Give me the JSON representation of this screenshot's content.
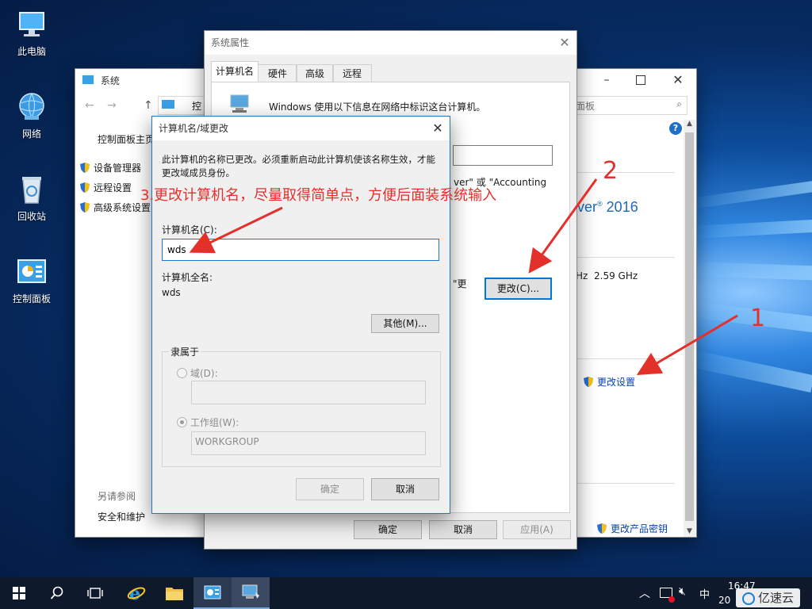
{
  "desktop": {
    "icons": [
      {
        "label": "此电脑",
        "icon": "computer-icon"
      },
      {
        "label": "网络",
        "icon": "network-globe-icon"
      },
      {
        "label": "回收站",
        "icon": "recycle-bin-icon"
      },
      {
        "label": "控制面板",
        "icon": "control-panel-icon"
      }
    ]
  },
  "system_window": {
    "title": "系统",
    "address": "控",
    "search_hint": "面板",
    "sidebar": {
      "home": "控制面板主页",
      "items": [
        "设备管理器",
        "远程设置",
        "高级系统设置"
      ],
      "see_also": "另请参阅",
      "see_also_items": [
        "安全和维护"
      ]
    },
    "os_name": "ver",
    "os_year": "2016",
    "cpu_hz": "Hz",
    "cpu_speed": "2.59 GHz",
    "change_settings": "更改设置",
    "change_key": "更改产品密钥"
  },
  "sysprop": {
    "title": "系统属性",
    "tabs": [
      "计算机名",
      "硬件",
      "高级",
      "远程"
    ],
    "intro": "Windows 使用以下信息在网络中标识这台计算机。",
    "frag_account_a": "ver\" 或 \"Accounting",
    "frag_quote": "\"更",
    "change_button": "更改(C)...",
    "ok": "确定",
    "cancel": "取消",
    "apply": "应用(A)"
  },
  "rename_dialog": {
    "title": "计算机名/域更改",
    "message": "此计算机的名称已更改。必须重新启动此计算机使该名称生效，才能更改域成员身份。",
    "name_label": "计算机名(C):",
    "name_value": "wds",
    "full_label": "计算机全名:",
    "full_value": "wds",
    "more_button": "其他(M)...",
    "member_of": "隶属于",
    "domain_label": "域(D):",
    "workgroup_label": "工作组(W):",
    "workgroup_value": "WORKGROUP",
    "ok": "确定",
    "cancel": "取消"
  },
  "annotations": {
    "step1": "1",
    "step2": "2",
    "step3": "3.更改计算机名，尽量取得简单点，方便后面装系统输入"
  },
  "taskbar": {
    "time": "16:47",
    "ime": "中",
    "date_frag": "20",
    "watermark": "亿速云"
  },
  "colors": {
    "accent": "#0078d7",
    "annotation": "#e4302b",
    "taskbar": "#0e1a2b"
  }
}
